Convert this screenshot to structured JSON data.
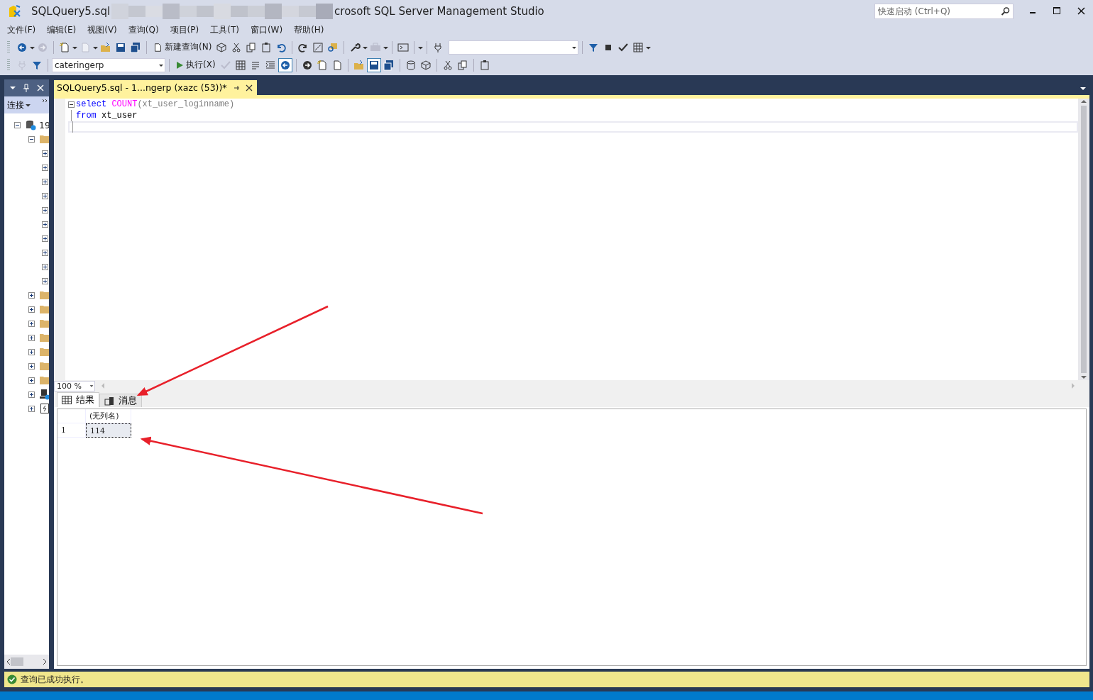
{
  "window": {
    "title_start": "SQLQuery5.sql",
    "title_end": "crosoft SQL Server Management Studio",
    "quick_launch": {
      "placeholder": "快速启动 (Ctrl+Q)"
    }
  },
  "menu": [
    "文件(F)",
    "编辑(E)",
    "视图(V)",
    "查询(Q)",
    "项目(P)",
    "工具(T)",
    "窗口(W)",
    "帮助(H)"
  ],
  "toolbar_1": [
    {
      "kind": "icon",
      "disabled": false
    },
    {
      "kind": "caret"
    },
    {
      "kind": "icon",
      "disabled": true
    },
    {
      "kind": "separator"
    },
    {
      "kind": "icon",
      "disabled": false
    },
    {
      "kind": "caret"
    },
    {
      "kind": "icon",
      "disabled": true
    },
    {
      "kind": "caret"
    },
    {
      "kind": "icon",
      "disabled": false
    },
    {
      "kind": "icon",
      "disabled": false
    },
    {
      "kind": "icon",
      "disabled": false
    },
    {
      "kind": "separator"
    },
    {
      "kind": "button",
      "label": "新建查询(N)"
    },
    {
      "kind": "icon",
      "disabled": false
    },
    {
      "kind": "icon",
      "disabled": false
    },
    {
      "kind": "icon",
      "disabled": false
    },
    {
      "kind": "icon",
      "disabled": false
    },
    {
      "kind": "icon",
      "disabled": false
    },
    {
      "kind": "separator"
    },
    {
      "kind": "icon",
      "disabled": false
    },
    {
      "kind": "icon",
      "disabled": false
    },
    {
      "kind": "icon",
      "disabled": false
    },
    {
      "kind": "separator"
    },
    {
      "kind": "icon",
      "disabled": false
    },
    {
      "kind": "caret"
    },
    {
      "kind": "icon",
      "disabled": true
    },
    {
      "kind": "caret"
    },
    {
      "kind": "separator"
    },
    {
      "kind": "icon",
      "disabled": false
    },
    {
      "kind": "separator"
    },
    {
      "kind": "caret"
    },
    {
      "kind": "separator"
    },
    {
      "kind": "icon",
      "disabled": false
    },
    {
      "kind": "combo"
    },
    {
      "kind": "separator"
    },
    {
      "kind": "icon",
      "disabled": false
    },
    {
      "kind": "icon",
      "disabled": false
    },
    {
      "kind": "icon",
      "disabled": false
    },
    {
      "kind": "icon",
      "disabled": false
    },
    {
      "kind": "caret"
    }
  ],
  "toolbar_2": [
    {
      "kind": "icon",
      "disabled": true
    },
    {
      "kind": "icon",
      "disabled": false
    },
    {
      "kind": "separator"
    },
    {
      "kind": "combo",
      "value": "cateringerp"
    },
    {
      "kind": "separator"
    },
    {
      "kind": "button",
      "label": "执行(X)"
    },
    {
      "kind": "icon",
      "disabled": true
    },
    {
      "kind": "icon",
      "disabled": false
    },
    {
      "kind": "icon",
      "disabled": false
    },
    {
      "kind": "icon",
      "disabled": false
    },
    {
      "kind": "icon",
      "disabled": false,
      "selected": true
    },
    {
      "kind": "separator"
    },
    {
      "kind": "icon",
      "disabled": false
    },
    {
      "kind": "icon",
      "disabled": false
    },
    {
      "kind": "icon",
      "disabled": false
    },
    {
      "kind": "separator"
    },
    {
      "kind": "icon",
      "disabled": false
    },
    {
      "kind": "icon",
      "disabled": false,
      "selected": true
    },
    {
      "kind": "icon",
      "disabled": false
    },
    {
      "kind": "separator"
    },
    {
      "kind": "icon",
      "disabled": false
    },
    {
      "kind": "icon",
      "disabled": false
    },
    {
      "kind": "separator"
    },
    {
      "kind": "icon",
      "disabled": false
    },
    {
      "kind": "icon",
      "disabled": false
    },
    {
      "kind": "separator"
    },
    {
      "kind": "icon",
      "disabled": false
    }
  ],
  "object_explorer": {
    "connect_label": "连接",
    "tree": [
      {
        "kind": "server",
        "label": "19",
        "expanded": true,
        "children": [
          {
            "kind": "folder",
            "expanded": true,
            "children": [
              {
                "expanded": false
              },
              {
                "expanded": false
              },
              {
                "expanded": false
              },
              {
                "expanded": false
              },
              {
                "expanded": false
              },
              {
                "expanded": false
              },
              {
                "expanded": false
              },
              {
                "expanded": false
              },
              {
                "expanded": false
              },
              {
                "expanded": false
              }
            ]
          },
          {
            "kind": "folder",
            "expanded": false
          },
          {
            "kind": "folder",
            "expanded": false
          },
          {
            "kind": "folder",
            "expanded": false
          },
          {
            "kind": "folder",
            "expanded": false
          },
          {
            "kind": "folder",
            "expanded": false
          },
          {
            "kind": "folder",
            "expanded": false
          },
          {
            "kind": "folder",
            "expanded": false
          },
          {
            "kind": "agent",
            "expanded": false
          },
          {
            "kind": "log",
            "expanded": false
          }
        ]
      }
    ]
  },
  "document_tabs": [
    {
      "label": "SQLQuery5.sql - 1...ngerp (xazc (53))*",
      "selected": true
    }
  ],
  "editor": {
    "lines": [
      {
        "fold": true,
        "current": false,
        "tokens": [
          {
            "kind": "keyword",
            "text": "select"
          },
          {
            "kind": "function",
            "text": "COUNT"
          },
          {
            "kind": "punct",
            "text": "(xt_user_loginname)"
          }
        ]
      },
      {
        "fold": false,
        "current": false,
        "tokens": [
          {
            "kind": "keyword",
            "text": "from"
          },
          {
            "kind": "plain",
            "text": "xt_user"
          }
        ]
      },
      {
        "fold": false,
        "current": true
      }
    ],
    "zoom": "100 %"
  },
  "results": {
    "tabs": [
      {
        "label": "结果",
        "kind": "grid",
        "selected": true
      },
      {
        "label": "消息",
        "kind": "messages",
        "selected": false
      }
    ],
    "columns": [
      "(无列名)"
    ],
    "rows": [
      {
        "number": "1",
        "cells": [
          "114"
        ],
        "selected": true
      }
    ]
  },
  "status_bar": {
    "message": "查询已成功执行。",
    "success": true
  }
}
